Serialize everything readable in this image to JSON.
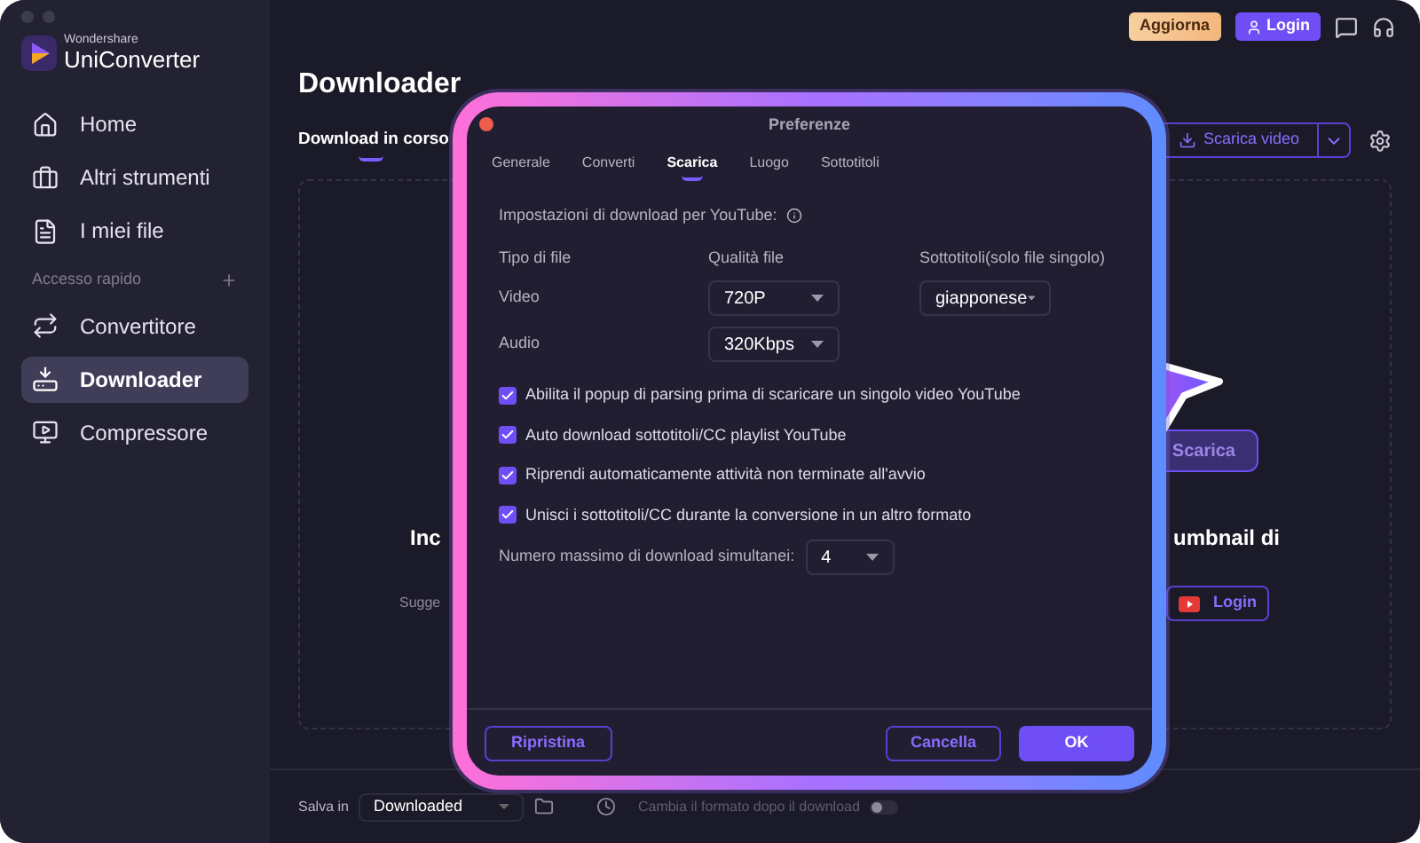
{
  "app": {
    "brand_small": "Wondershare",
    "brand": "UniConverter"
  },
  "sidebar": {
    "items": [
      {
        "kind": "home",
        "label": "Home",
        "selected": false
      },
      {
        "kind": "tools",
        "label": "Altri strumenti",
        "selected": false
      },
      {
        "kind": "files",
        "label": "I miei file",
        "selected": false
      }
    ],
    "section": "Accesso rapido",
    "quick_items": [
      {
        "kind": "convert",
        "label": "Convertitore",
        "selected": false
      },
      {
        "kind": "download",
        "label": "Downloader",
        "selected": true
      },
      {
        "kind": "compress",
        "label": "Compressore",
        "selected": false
      }
    ]
  },
  "top_bar": {
    "upgrade": "Aggiorna",
    "login": "Login"
  },
  "header": {
    "title": "Downloader",
    "tabs": [
      {
        "label": "Download in corso",
        "selected": true
      }
    ],
    "download_button": "Scarica video"
  },
  "background": {
    "heading_start": "Inc",
    "heading_end": "umbnail di",
    "hint_start": "Sugge",
    "download_button": "Scarica",
    "youtube_login": "Login"
  },
  "bottom_bar": {
    "save_label": "Salva in",
    "folder": "Downloaded",
    "convert_label": "Cambia il formato dopo il download",
    "convert_on": false
  },
  "dialog": {
    "title": "Preferenze",
    "tabs": [
      {
        "label": "Generale",
        "selected": false
      },
      {
        "label": "Converti",
        "selected": false
      },
      {
        "label": "Scarica",
        "selected": true
      },
      {
        "label": "Luogo",
        "selected": false
      },
      {
        "label": "Sottotitoli",
        "selected": false
      }
    ],
    "section": "Impostazioni di download per YouTube:",
    "columns": [
      "Tipo di file",
      "Qualità file",
      "Sottotitoli(solo file singolo)"
    ],
    "video_label": "Video",
    "video_quality": "720P",
    "subtitle_language": "giapponese",
    "audio_label": "Audio",
    "audio_quality": "320Kbps",
    "options": [
      {
        "label": "Abilita il popup di parsing prima di scaricare un singolo video YouTube",
        "checked": true
      },
      {
        "label": "Auto download sottotitoli/CC playlist YouTube",
        "checked": true
      },
      {
        "label": "Riprendi automaticamente attività non terminate all'avvio",
        "checked": true
      },
      {
        "label": "Unisci i sottotitoli/CC durante la conversione in un altro formato",
        "checked": true
      }
    ],
    "max_downloads_label": "Numero massimo di download simultanei:",
    "max_downloads": "4",
    "buttons": {
      "reset": "Ripristina",
      "cancel": "Cancella",
      "ok": "OK"
    }
  }
}
